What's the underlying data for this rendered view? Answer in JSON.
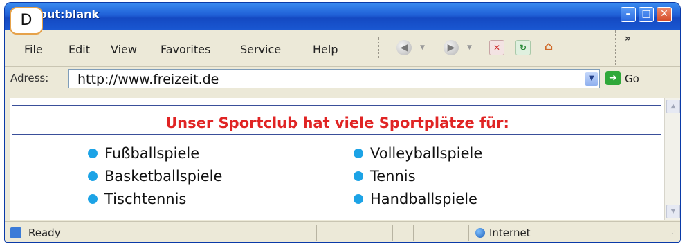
{
  "badge": "D",
  "window": {
    "title": "out:blank",
    "minimize_icon": "minimize-icon",
    "maximize_icon": "maximize-icon",
    "close_icon": "close-icon"
  },
  "menu": {
    "items": [
      "File",
      "Edit",
      "View",
      "Favorites",
      "Service",
      "Help"
    ],
    "overflow": "»"
  },
  "toolbar": {
    "icons": [
      "back-icon",
      "forward-icon",
      "stop-icon",
      "refresh-icon",
      "home-icon"
    ]
  },
  "address": {
    "label": "Adress:",
    "url": "http://www.freizeit.de",
    "go_label": "Go"
  },
  "page": {
    "heading": "Unser Sportclub hat viele Sportplätze für:",
    "left_items": [
      "Fußballspiele",
      "Basketballspiele",
      "Tischtennis"
    ],
    "right_items": [
      "Volleyballspiele",
      "Tennis",
      "Handballspiele"
    ],
    "heading_color": "#e02424",
    "bullet_color": "#1ca3e6"
  },
  "status": {
    "text": "Ready",
    "zone": "Internet"
  }
}
